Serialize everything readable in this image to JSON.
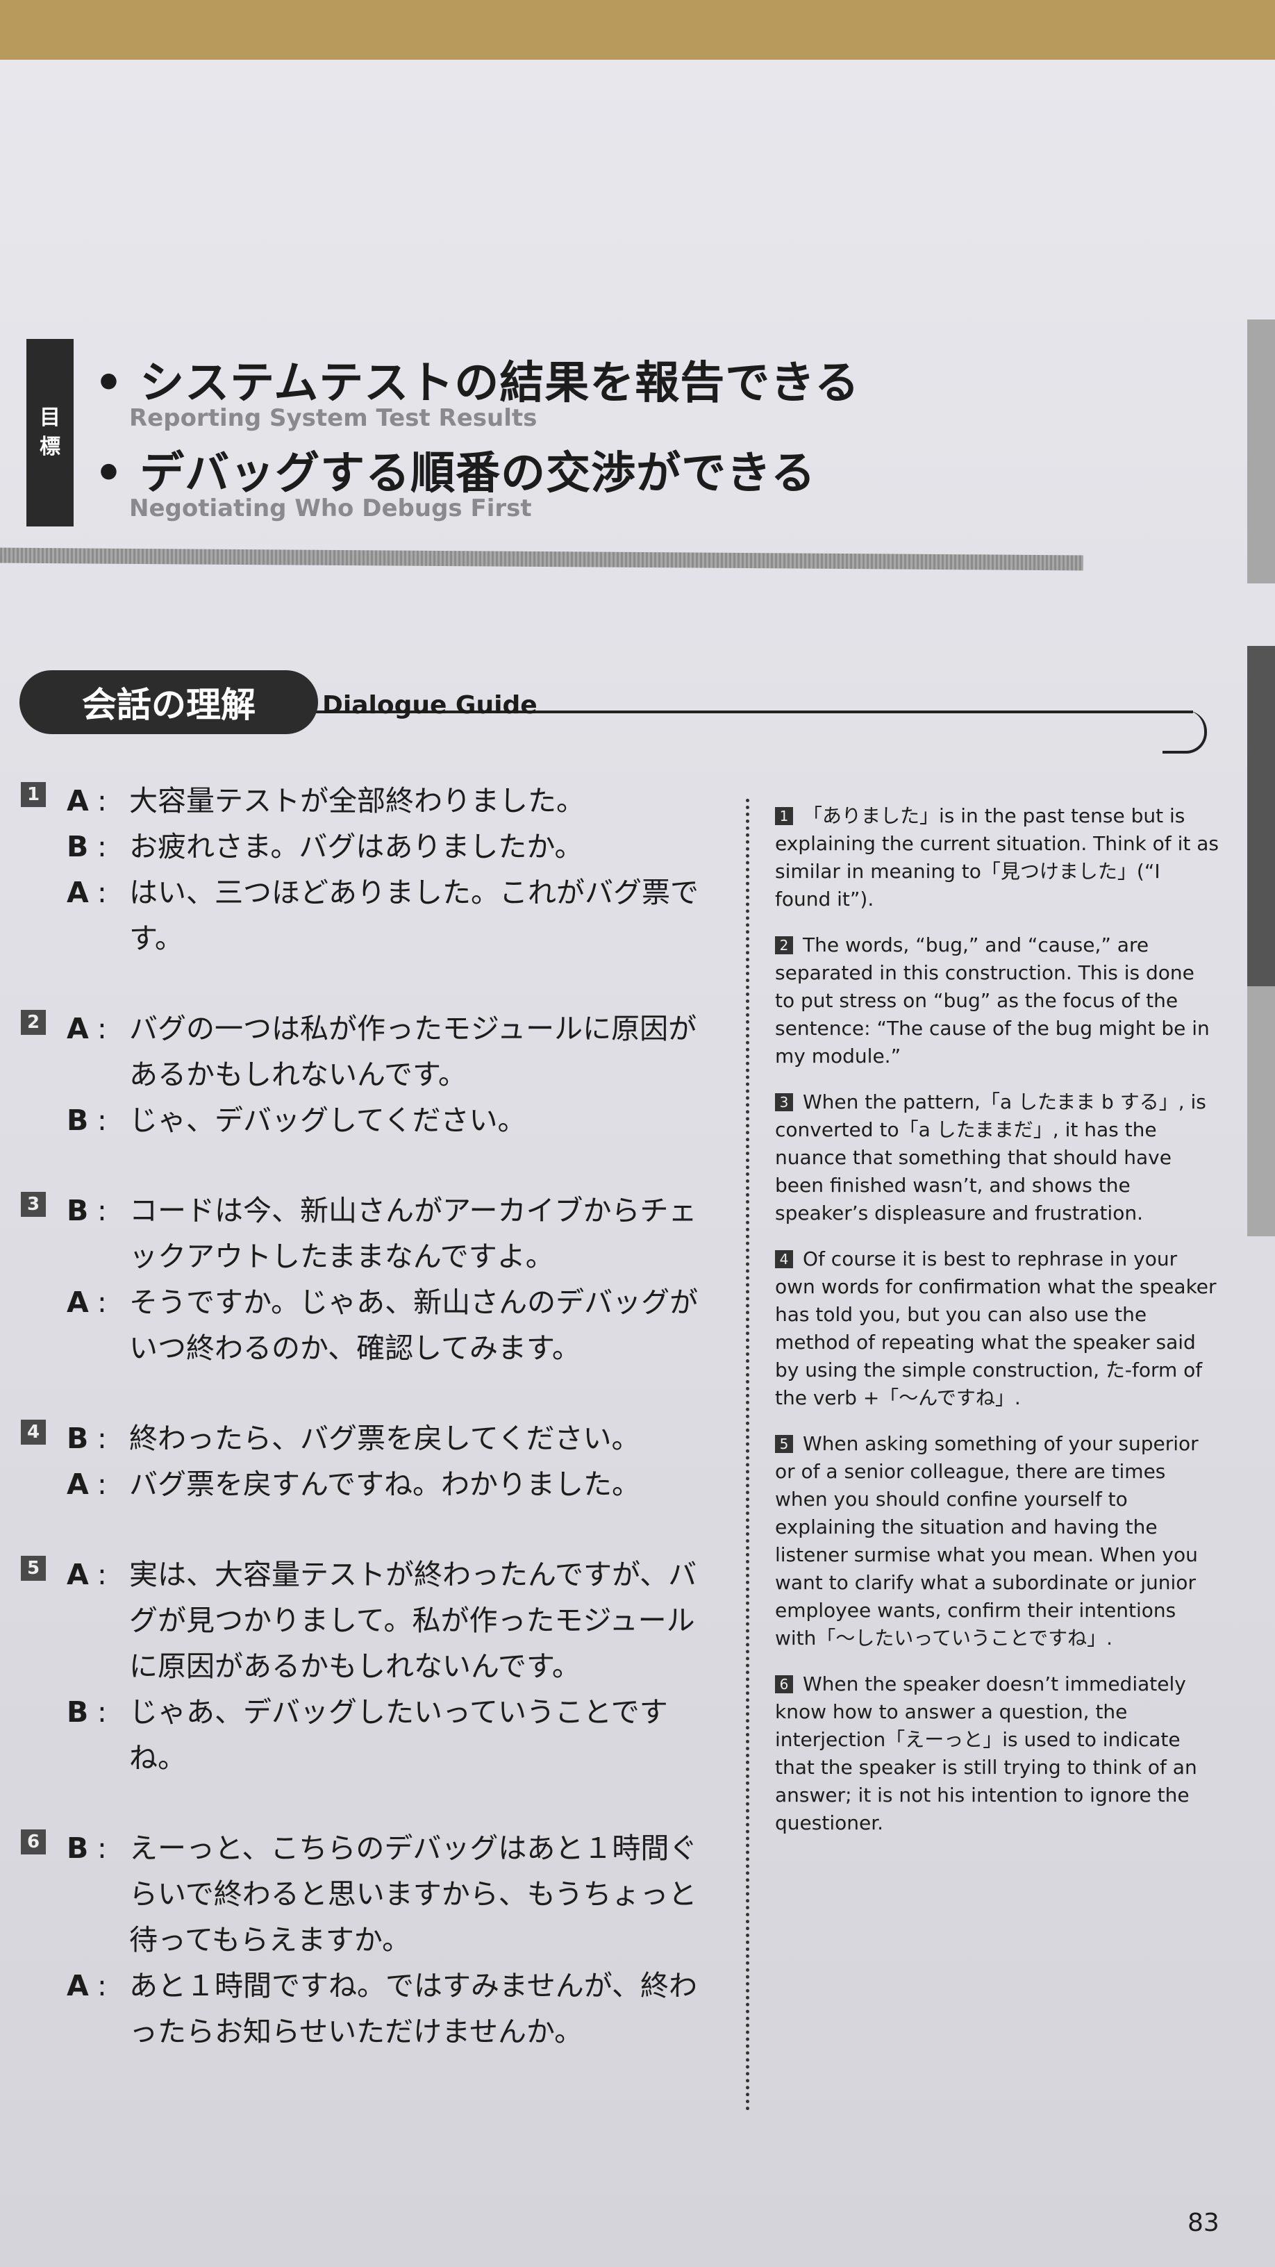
{
  "objectives": {
    "mark": [
      "目",
      "標"
    ],
    "items": [
      {
        "jp": "• システムテストの結果を報告できる",
        "en": "Reporting System Test Results"
      },
      {
        "jp": "• デバッグする順番の交渉ができる",
        "en": "Negotiating Who Debugs First"
      }
    ]
  },
  "section": {
    "jp": "会話の理解",
    "en": "Dialogue Guide"
  },
  "dialogues": [
    {
      "num": "1",
      "lines": [
        {
          "speaker": "A",
          "text": "大容量テストが全部終わりました。"
        },
        {
          "speaker": "B",
          "text": "お疲れさま。バグはありましたか。"
        },
        {
          "speaker": "A",
          "text": "はい、三つほどありました。これがバグ票です。"
        }
      ]
    },
    {
      "num": "2",
      "lines": [
        {
          "speaker": "A",
          "text": "バグの一つは私が作ったモジュールに原因があるかもしれないんです。"
        },
        {
          "speaker": "B",
          "text": "じゃ、デバッグしてください。"
        }
      ]
    },
    {
      "num": "3",
      "lines": [
        {
          "speaker": "B",
          "text": "コードは今、新山さんがアーカイブからチェックアウトしたままなんですよ。"
        },
        {
          "speaker": "A",
          "text": "そうですか。じゃあ、新山さんのデバッグがいつ終わるのか、確認してみます。"
        }
      ]
    },
    {
      "num": "4",
      "lines": [
        {
          "speaker": "B",
          "text": "終わったら、バグ票を戻してください。"
        },
        {
          "speaker": "A",
          "text": "バグ票を戻すんですね。わかりました。"
        }
      ]
    },
    {
      "num": "5",
      "lines": [
        {
          "speaker": "A",
          "text": "実は、大容量テストが終わったんですが、バグが見つかりまして。私が作ったモジュールに原因があるかもしれないんです。"
        },
        {
          "speaker": "B",
          "text": "じゃあ、デバッグしたいっていうことですね。"
        }
      ]
    },
    {
      "num": "6",
      "lines": [
        {
          "speaker": "B",
          "text": "えーっと、こちらのデバッグはあと１時間ぐらいで終わると思いますから、もうちょっと待ってもらえますか。"
        },
        {
          "speaker": "A",
          "text": "あと１時間ですね。ではすみませんが、終わったらお知らせいただけませんか。"
        }
      ]
    }
  ],
  "notes": [
    {
      "num": "1",
      "text": "「ありました」is in the past tense but is explaining the current situation. Think of it as similar in meaning to「見つけました」(“I found it”)."
    },
    {
      "num": "2",
      "text": "The words, “bug,” and “cause,” are separated in this construction. This is done to put stress on “bug” as the focus of the sentence: “The cause of the bug might be in my module.”"
    },
    {
      "num": "3",
      "text": "When the pattern,「a したまま b する」, is converted to「a したままだ」, it has the nuance that something that should have been finished wasn’t, and shows the speaker’s displeasure and frustration."
    },
    {
      "num": "4",
      "text": "Of course it is best to rephrase in your own words for confirmation what the speaker has told you, but you can also use the method of repeating what the speaker said by using the simple construction, た-form of the verb +「～んですね」."
    },
    {
      "num": "5",
      "text": "When asking something of your superior or of a senior colleague, there are times when you should confine yourself to explaining the situation and having the listener surmise what you mean. When you want to clarify what a subordinate or junior employee wants, confirm their intentions with「～したいっていうことですね」."
    },
    {
      "num": "6",
      "text": "When the speaker doesn’t immediately know how to answer a question, the interjection「えーっと」is used to indicate that the speaker is still trying to think of an answer; it is not his intention to ignore the questioner."
    }
  ],
  "page_number": "83"
}
